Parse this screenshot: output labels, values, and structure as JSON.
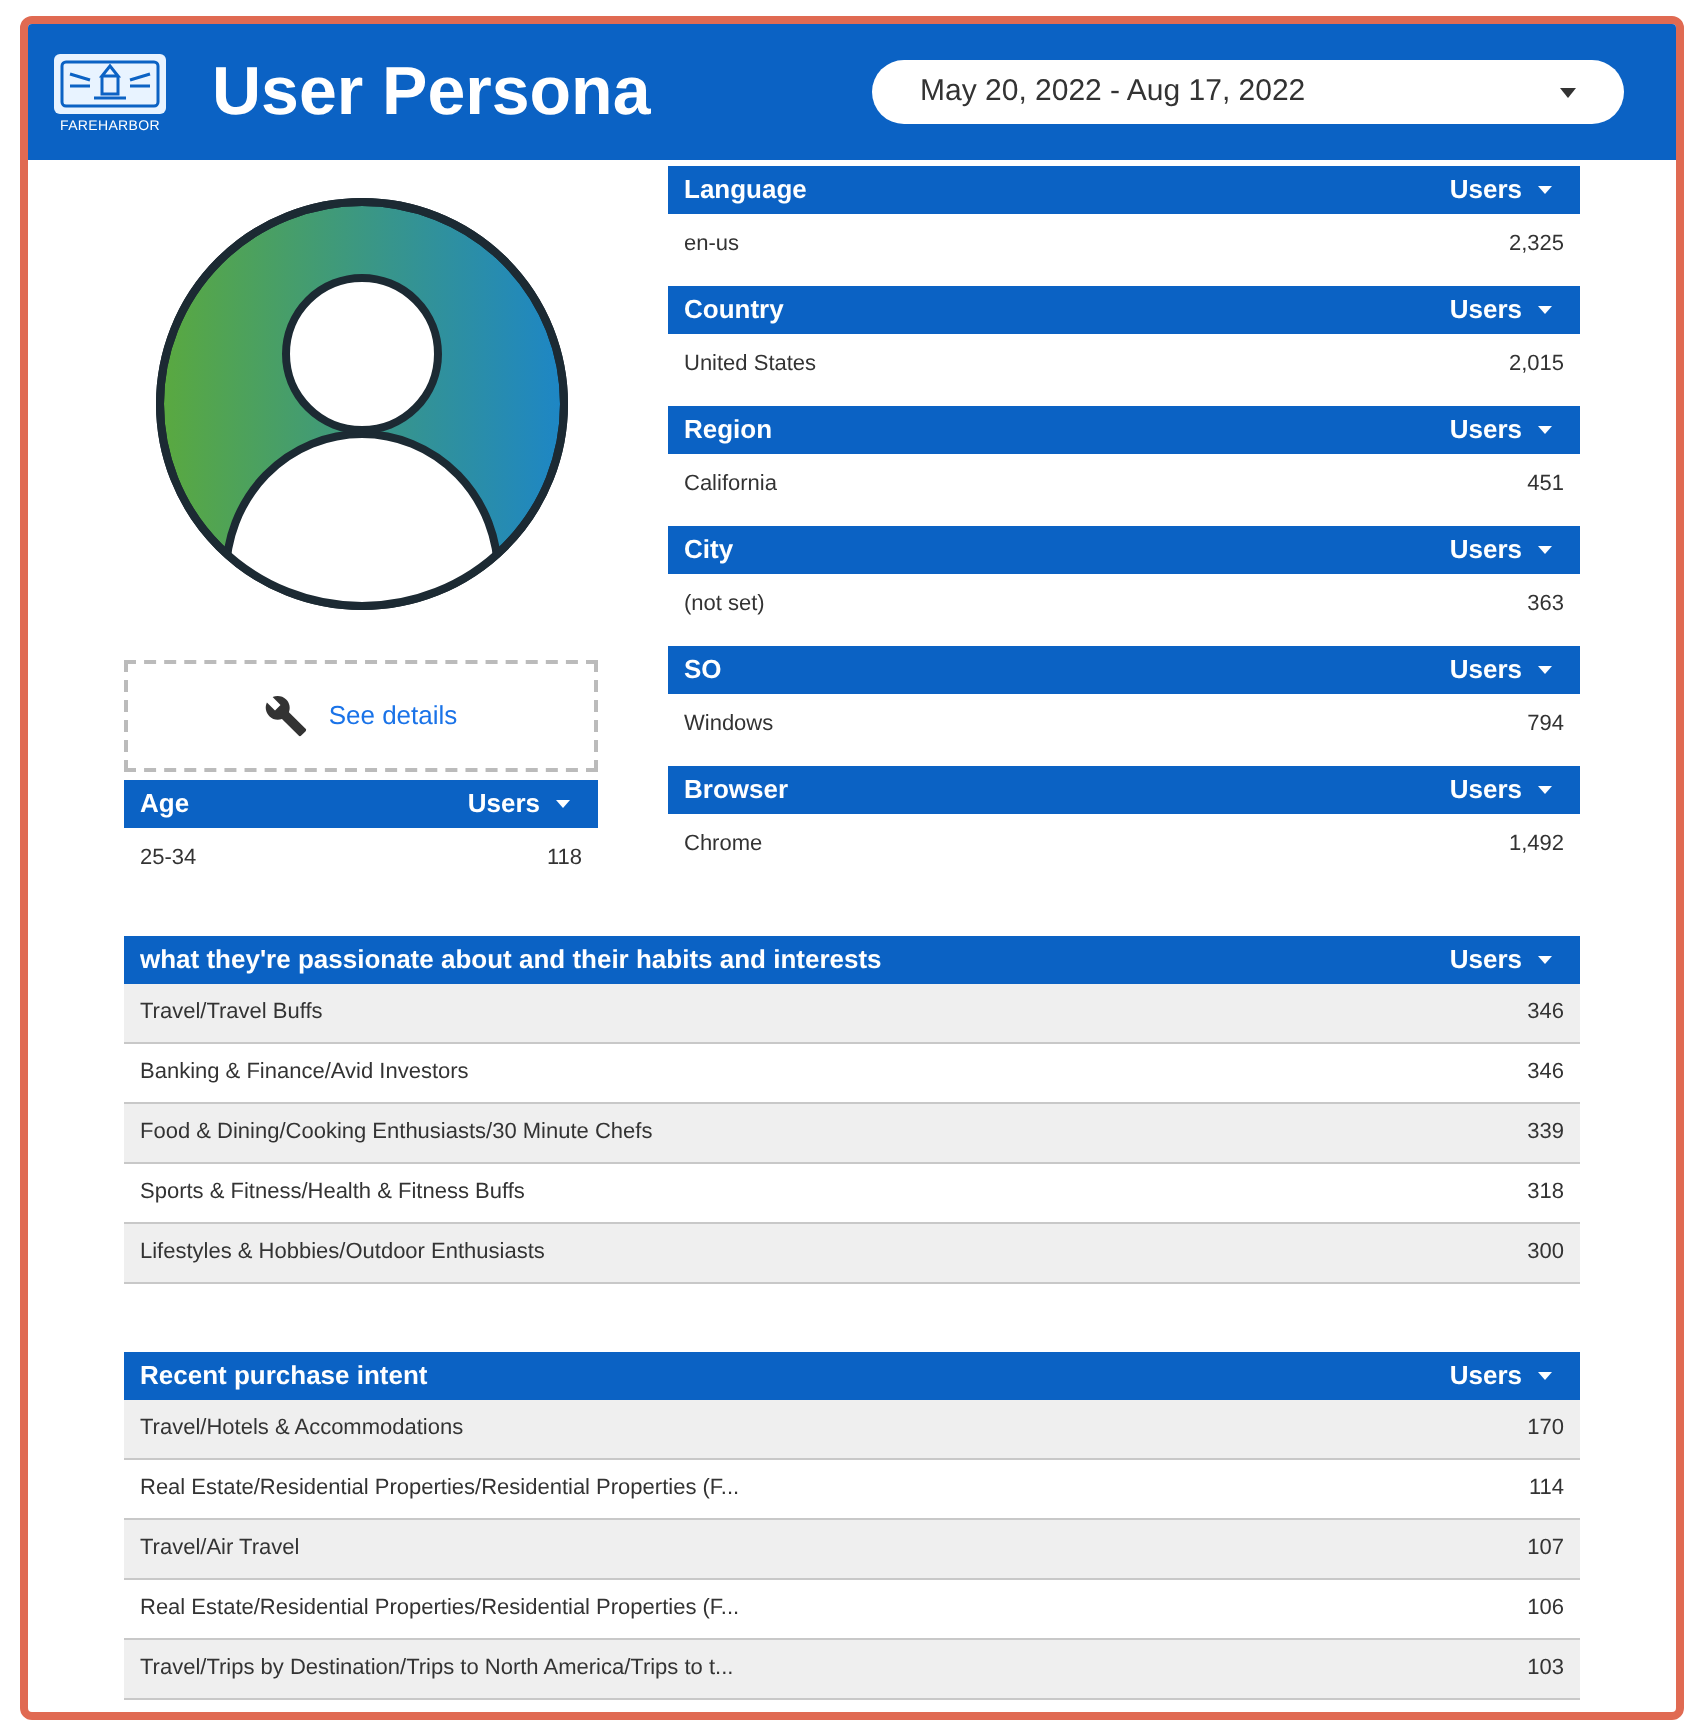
{
  "header": {
    "logo_text": "FAREHARBOR",
    "title": "User Persona",
    "date_range": "May 20, 2022 - Aug 17, 2022"
  },
  "details_link": "See details",
  "age_table": {
    "dimension": "Age",
    "metric": "Users",
    "rows": [
      {
        "label": "25-34",
        "value": "118"
      }
    ]
  },
  "side_tables": [
    {
      "dimension": "Language",
      "metric": "Users",
      "rows": [
        {
          "label": "en-us",
          "value": "2,325"
        }
      ]
    },
    {
      "dimension": "Country",
      "metric": "Users",
      "rows": [
        {
          "label": "United States",
          "value": "2,015"
        }
      ]
    },
    {
      "dimension": "Region",
      "metric": "Users",
      "rows": [
        {
          "label": "California",
          "value": "451"
        }
      ]
    },
    {
      "dimension": "City",
      "metric": "Users",
      "rows": [
        {
          "label": "(not set)",
          "value": "363"
        }
      ]
    },
    {
      "dimension": "SO",
      "metric": "Users",
      "rows": [
        {
          "label": "Windows",
          "value": "794"
        }
      ]
    },
    {
      "dimension": "Browser",
      "metric": "Users",
      "rows": [
        {
          "label": "Chrome",
          "value": "1,492"
        }
      ]
    }
  ],
  "wide_tables": [
    {
      "dimension": "what they're passionate about and their habits and interests",
      "metric": "Users",
      "rows": [
        {
          "label": "Travel/Travel Buffs",
          "value": "346"
        },
        {
          "label": "Banking & Finance/Avid Investors",
          "value": "346"
        },
        {
          "label": "Food & Dining/Cooking Enthusiasts/30 Minute Chefs",
          "value": "339"
        },
        {
          "label": "Sports & Fitness/Health & Fitness Buffs",
          "value": "318"
        },
        {
          "label": "Lifestyles & Hobbies/Outdoor Enthusiasts",
          "value": "300"
        }
      ]
    },
    {
      "dimension": "Recent purchase intent",
      "metric": "Users",
      "rows": [
        {
          "label": "Travel/Hotels & Accommodations",
          "value": "170"
        },
        {
          "label": "Real Estate/Residential Properties/Residential Properties (F...",
          "value": "114"
        },
        {
          "label": "Travel/Air Travel",
          "value": "107"
        },
        {
          "label": "Real Estate/Residential Properties/Residential Properties (F...",
          "value": "106"
        },
        {
          "label": "Travel/Trips by Destination/Trips to North America/Trips to t...",
          "value": "103"
        }
      ]
    }
  ]
}
